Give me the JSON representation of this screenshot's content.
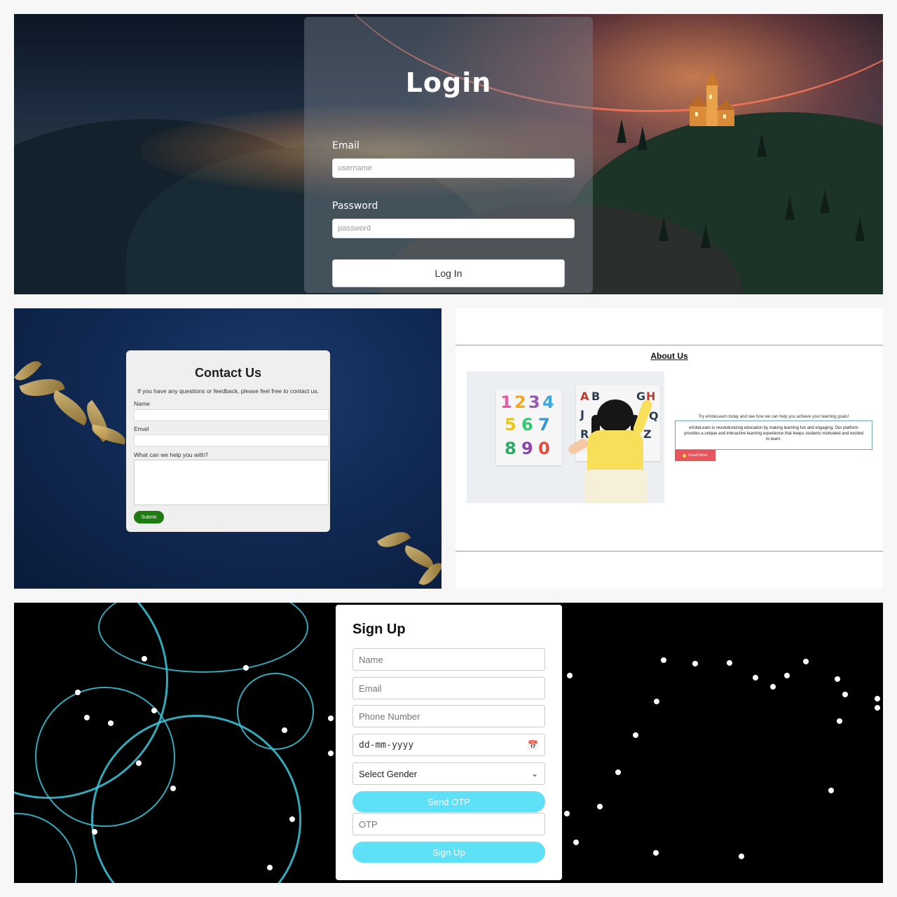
{
  "login": {
    "title": "Login",
    "email_label": "Email",
    "email_placeholder": "username",
    "password_label": "Password",
    "password_placeholder": "password",
    "submit_label": "Log In"
  },
  "contact": {
    "title": "Contact Us",
    "subtitle": "If you have any questions or feedback, please feel free to contact us.",
    "name_label": "Name",
    "email_label": "Email",
    "message_label": "What can we help you with?",
    "submit_label": "Submit"
  },
  "about": {
    "title": "About Us",
    "tagline": "Try eXoteLearn today and see how we can help you achieve your learning goals!",
    "description": "eXoteLearn is revolutionizing education by making learning fun and engaging. Our platform provides a unique and interactive learning experience that keeps students motivated and excited to learn.",
    "read_more_label": "Read More"
  },
  "signup": {
    "title": "Sign Up",
    "name_placeholder": "Name",
    "email_placeholder": "Email",
    "phone_placeholder": "Phone Number",
    "date_placeholder": "dd-mm-yyyy",
    "gender_selected": "Select Gender",
    "send_otp_label": "Send OTP",
    "otp_placeholder": "OTP",
    "submit_label": "Sign Up"
  },
  "colors": {
    "signup_button": "#5ee1f7",
    "contact_submit": "#1f7a12",
    "read_more": "#e8565d"
  },
  "icons": [
    "calendar-icon",
    "chevron-down-icon",
    "star-icon"
  ]
}
